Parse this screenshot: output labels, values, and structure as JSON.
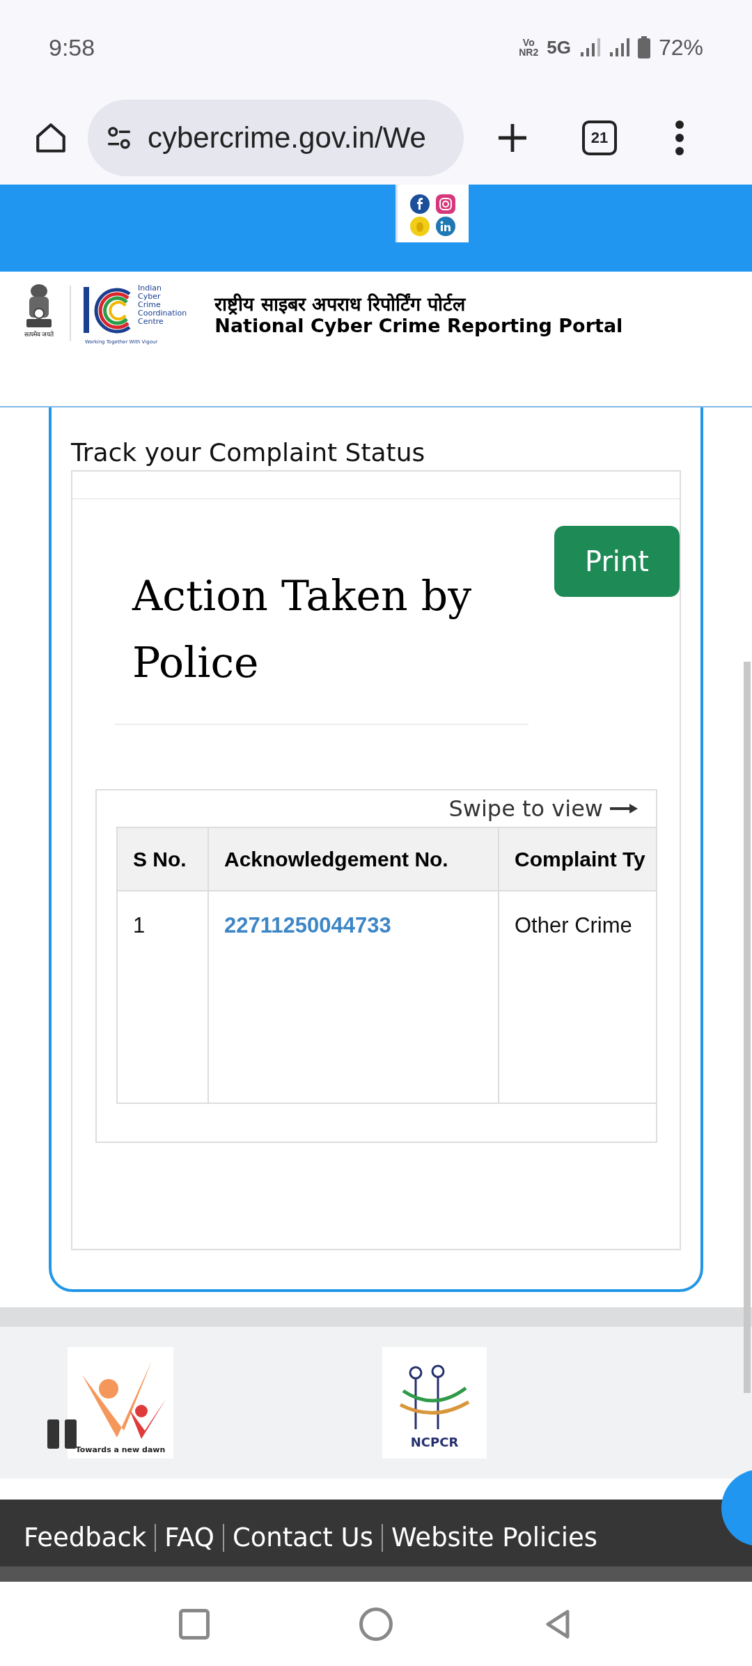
{
  "status_bar": {
    "time": "9:58",
    "volte": [
      "Vo",
      "NR2"
    ],
    "network": "5G",
    "battery": "72%"
  },
  "browser": {
    "url": "cybercrime.gov.in/We",
    "tab_count": "21"
  },
  "header": {
    "emblem_motto": "सत्यमेव जयते",
    "logo_lines": [
      "Indian",
      "Cyber",
      "Crime",
      "Coordination",
      "Centre"
    ],
    "logo_tagline": "Working Together With Vigour",
    "title_hindi": "राष्ट्रीय साइबर अपराध रिपोर्टिंग पोर्टल",
    "title_english": "National Cyber Crime Reporting Portal"
  },
  "page": {
    "section_title": "Track your Complaint Status",
    "heading": "Action Taken by Police",
    "print_button": "Print",
    "swipe_hint": "Swipe to view",
    "table": {
      "columns": [
        "S No.",
        "Acknowledgement No.",
        "Complaint Ty"
      ],
      "rows": [
        [
          "1",
          "22711250044733",
          "Other Crime"
        ]
      ]
    }
  },
  "partner_logos": [
    {
      "caption": "Towards a new dawn"
    },
    {
      "caption": "NCPCR"
    }
  ],
  "footer_links": [
    "Feedback",
    "FAQ",
    "Contact Us",
    "Website Policies"
  ]
}
